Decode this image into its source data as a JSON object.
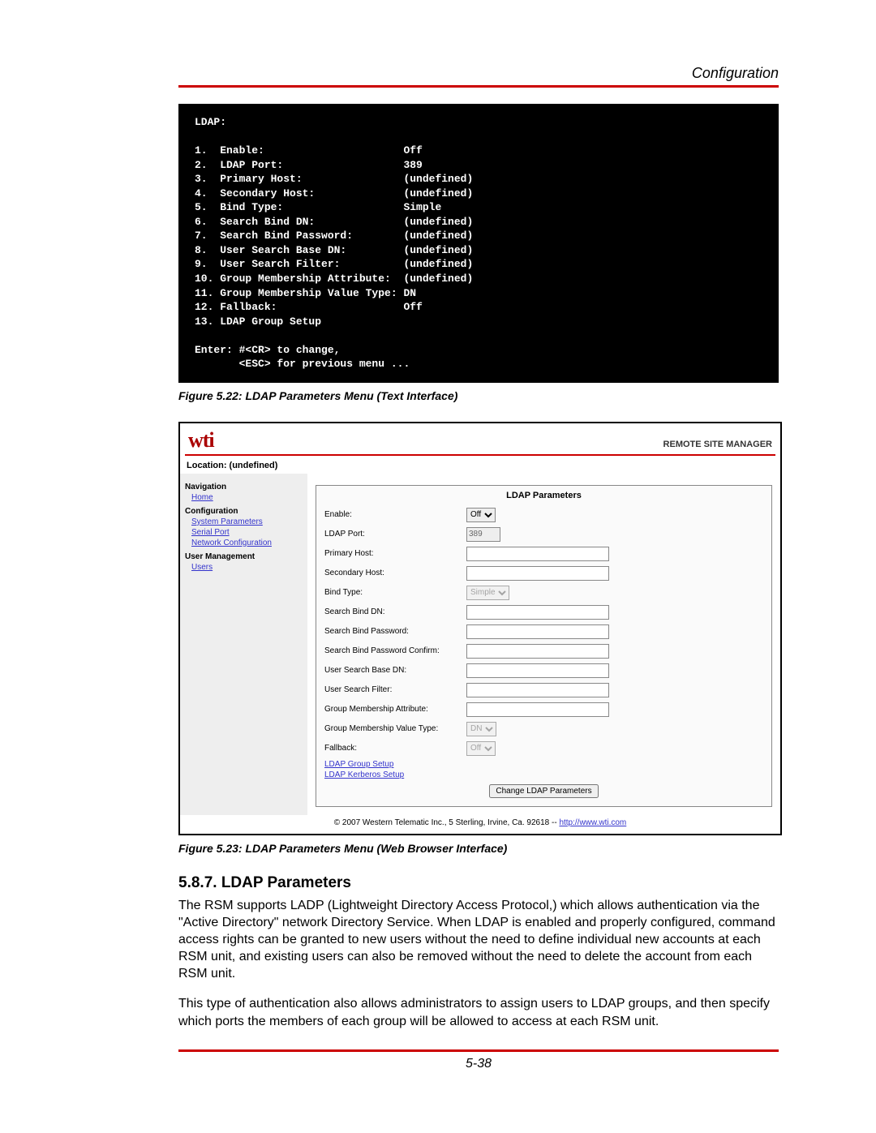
{
  "header": {
    "title": "Configuration"
  },
  "terminal": {
    "title": "LDAP:",
    "items": [
      {
        "n": "1.",
        "label": "Enable:",
        "val": "Off"
      },
      {
        "n": "2.",
        "label": "LDAP Port:",
        "val": "389"
      },
      {
        "n": "3.",
        "label": "Primary Host:",
        "val": "(undefined)"
      },
      {
        "n": "4.",
        "label": "Secondary Host:",
        "val": "(undefined)"
      },
      {
        "n": "5.",
        "label": "Bind Type:",
        "val": "Simple"
      },
      {
        "n": "6.",
        "label": "Search Bind DN:",
        "val": "(undefined)"
      },
      {
        "n": "7.",
        "label": "Search Bind Password:",
        "val": "(undefined)"
      },
      {
        "n": "8.",
        "label": "User Search Base DN:",
        "val": "(undefined)"
      },
      {
        "n": "9.",
        "label": "User Search Filter:",
        "val": "(undefined)"
      },
      {
        "n": "10.",
        "label": "Group Membership Attribute:",
        "val": "(undefined)"
      },
      {
        "n": "11.",
        "label": "Group Membership Value Type:",
        "val": "DN"
      },
      {
        "n": "12.",
        "label": "Fallback:",
        "val": "Off"
      },
      {
        "n": "13.",
        "label": "LDAP Group Setup",
        "val": ""
      }
    ],
    "prompt1": "Enter: #<CR> to change,",
    "prompt2": "       <ESC> for previous menu ..."
  },
  "fig22": "Figure 5.22:  LDAP Parameters Menu (Text Interface)",
  "web": {
    "logo": "wti",
    "product": "REMOTE SITE MANAGER",
    "location": "Location: (undefined)",
    "nav": {
      "nav_label": "Navigation",
      "home": "Home",
      "config_label": "Configuration",
      "sys_params": "System Parameters",
      "serial_port": "Serial Port",
      "net_config": "Network Configuration",
      "um_label": "User Management",
      "users": "Users"
    },
    "params": {
      "title": "LDAP Parameters",
      "rows": {
        "enable": "Enable:",
        "enable_val": "Off",
        "port": "LDAP Port:",
        "port_val": "389",
        "phost": "Primary Host:",
        "shost": "Secondary Host:",
        "bindtype": "Bind Type:",
        "bindtype_val": "Simple",
        "sbdn": "Search Bind DN:",
        "sbpw": "Search Bind Password:",
        "sbpwc": "Search Bind Password Confirm:",
        "usbdn": "User Search Base DN:",
        "usf": "User Search Filter:",
        "gma": "Group Membership Attribute:",
        "gmvt": "Group Membership Value Type:",
        "gmvt_val": "DN",
        "fallback": "Fallback:",
        "fallback_val": "Off"
      },
      "link1": "LDAP Group Setup",
      "link2": "LDAP Kerberos Setup",
      "button": "Change LDAP Parameters"
    },
    "footer_text": "© 2007 Western Telematic Inc., 5 Sterling, Irvine, Ca. 92618 -- ",
    "footer_link": "http://www.wti.com"
  },
  "fig23": "Figure 5.23:  LDAP Parameters Menu (Web Browser Interface)",
  "section": {
    "heading": "5.8.7.   LDAP Parameters",
    "p1": "The RSM supports LADP (Lightweight Directory Access Protocol,) which allows authentication via the \"Active Directory\" network Directory Service.  When LDAP is enabled and properly configured, command access rights can be granted to new users without the need to define individual new accounts at each RSM unit, and existing users can also be removed without the need to delete the account from each RSM unit.",
    "p2": "This type of authentication also allows administrators to assign users to LDAP groups, and then specify which ports the members of each group will be allowed to access at each RSM unit."
  },
  "page_number": "5-38"
}
